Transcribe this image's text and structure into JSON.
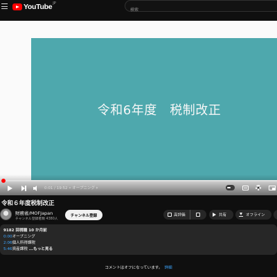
{
  "header": {
    "logo_text": "YouTube",
    "region": "JP",
    "search_placeholder": "検索"
  },
  "player": {
    "slide_title": "令和6年度　税制改正",
    "time_display": "0:01 / 19:52",
    "chapter_label": "• オープニング",
    "chapter_chevron": "›",
    "quality_badge": "HD",
    "progress_fraction": 0.0008
  },
  "video": {
    "title": "令和６年度税制改正"
  },
  "channel": {
    "name": "財務省/MOFJapan",
    "subscribers": "チャンネル登録者数 4380人",
    "subscribe_label": "チャンネル登録"
  },
  "actions": {
    "like_label": "高評価",
    "share_label": "共有",
    "offline_label": "オフライン"
  },
  "description": {
    "views_line": "9182 回視聴  10 か月前",
    "chapters": [
      {
        "time": "0:00",
        "label": "オープニング"
      },
      {
        "time": "2:06",
        "label": "個人所得課税"
      },
      {
        "time": "5:46",
        "label": "資産課税"
      }
    ],
    "more_label": "...もっと見る"
  },
  "comments": {
    "off_text": "コメントはオフになっています。",
    "details_link": "詳細"
  },
  "colors": {
    "slide_bg": "#4ea8ad",
    "accent_red": "#ff0000",
    "link_blue": "#3ea6ff"
  },
  "icons": [
    "menu-icon",
    "youtube-logo-icon",
    "play-icon",
    "next-icon",
    "volume-icon",
    "captions-icon",
    "gear-icon",
    "miniplayer-icon",
    "thumb-up-icon",
    "thumb-down-icon",
    "share-icon",
    "download-icon"
  ]
}
